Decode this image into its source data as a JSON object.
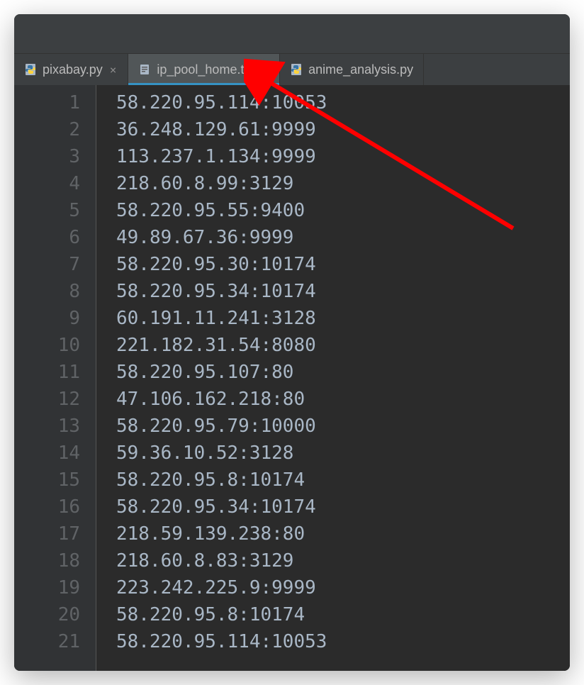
{
  "tabs": [
    {
      "label": "pixabay.py",
      "type": "python",
      "active": false
    },
    {
      "label": "ip_pool_home.txt",
      "type": "text",
      "active": true
    },
    {
      "label": "anime_analysis.py",
      "type": "python",
      "active": false
    }
  ],
  "lines": [
    {
      "num": "1",
      "content": "58.220.95.114:10053"
    },
    {
      "num": "2",
      "content": "36.248.129.61:9999"
    },
    {
      "num": "3",
      "content": "113.237.1.134:9999"
    },
    {
      "num": "4",
      "content": "218.60.8.99:3129"
    },
    {
      "num": "5",
      "content": "58.220.95.55:9400"
    },
    {
      "num": "6",
      "content": "49.89.67.36:9999"
    },
    {
      "num": "7",
      "content": "58.220.95.30:10174"
    },
    {
      "num": "8",
      "content": "58.220.95.34:10174"
    },
    {
      "num": "9",
      "content": "60.191.11.241:3128"
    },
    {
      "num": "10",
      "content": "221.182.31.54:8080"
    },
    {
      "num": "11",
      "content": "58.220.95.107:80"
    },
    {
      "num": "12",
      "content": "47.106.162.218:80"
    },
    {
      "num": "13",
      "content": "58.220.95.79:10000"
    },
    {
      "num": "14",
      "content": "59.36.10.52:3128"
    },
    {
      "num": "15",
      "content": "58.220.95.8:10174"
    },
    {
      "num": "16",
      "content": "58.220.95.34:10174"
    },
    {
      "num": "17",
      "content": "218.59.139.238:80"
    },
    {
      "num": "18",
      "content": "218.60.8.83:3129"
    },
    {
      "num": "19",
      "content": "223.242.225.9:9999"
    },
    {
      "num": "20",
      "content": "58.220.95.8:10174"
    },
    {
      "num": "21",
      "content": "58.220.95.114:10053"
    }
  ]
}
